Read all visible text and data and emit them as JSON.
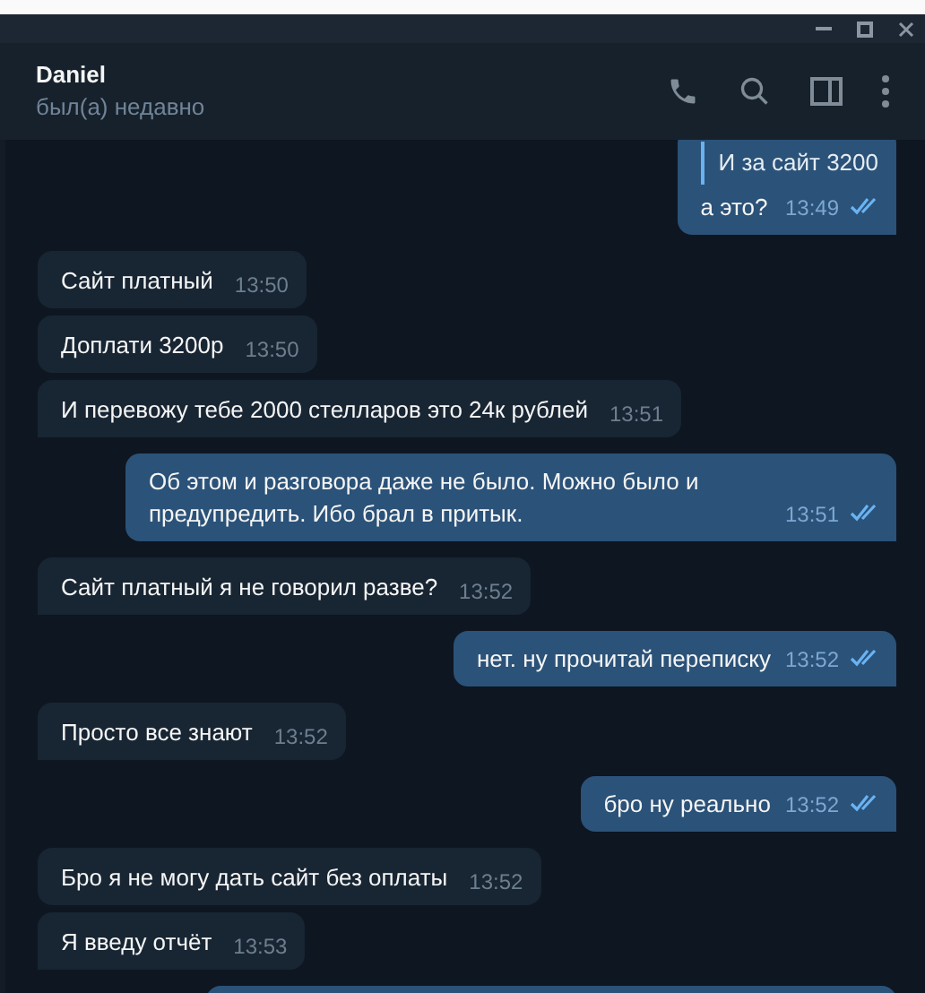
{
  "header": {
    "name": "Daniel",
    "status": "был(а) недавно"
  },
  "messages": [
    {
      "kind": "outgoing",
      "quote": "И за сайт 3200",
      "text": "а это?",
      "time": "13:49",
      "read": true
    },
    {
      "kind": "incoming",
      "text": "Сайт платный",
      "time": "13:50",
      "tail": false
    },
    {
      "kind": "incoming",
      "text": "Доплати 3200р",
      "time": "13:50",
      "tail": false
    },
    {
      "kind": "incoming",
      "text": "И перевожу тебе 2000 стелларов это 24к рублей",
      "time": "13:51",
      "tail": true
    },
    {
      "kind": "outgoing",
      "text": "Об этом и разговора даже не было. Можно было и предупредить. Ибо брал в притык.",
      "time": "13:51",
      "read": true
    },
    {
      "kind": "incoming",
      "text": "Сайт платный я не говорил разве?",
      "time": "13:52",
      "tail": true
    },
    {
      "kind": "outgoing",
      "text": "нет. ну прочитай переписку",
      "time": "13:52",
      "read": true
    },
    {
      "kind": "incoming",
      "text": "Просто все знают",
      "time": "13:52",
      "tail": true
    },
    {
      "kind": "outgoing",
      "text": "бро ну реально",
      "time": "13:52",
      "read": true
    },
    {
      "kind": "incoming",
      "text": "Бро я не могу дать сайт без оплаты",
      "time": "13:52",
      "tail": false
    },
    {
      "kind": "incoming",
      "text": "Я введу отчёт",
      "time": "13:53",
      "tail": true
    },
    {
      "kind": "cut"
    }
  ]
}
